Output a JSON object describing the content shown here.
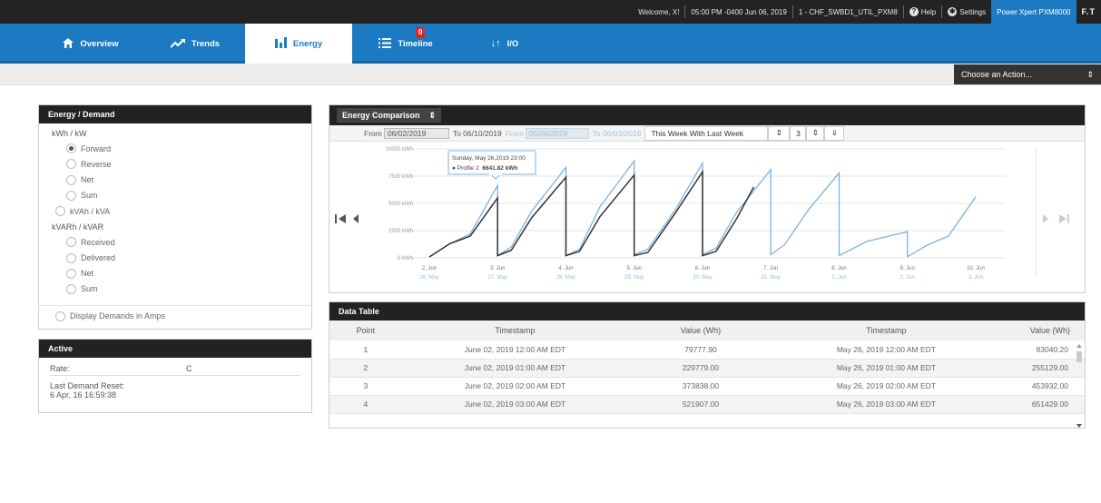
{
  "topbar": {
    "welcome": "Welcome, X!",
    "datetime": "05:00 PM -0400 Jun 06, 2019",
    "device_id": "1 - CHF_SWBD1_UTIL_PXM8",
    "help": "Help",
    "settings": "Settings",
    "product": "Power Xpert PXM8000",
    "logo": "F.T"
  },
  "nav": {
    "tabs": [
      {
        "label": "Overview",
        "icon": "home-icon"
      },
      {
        "label": "Trends",
        "icon": "trend-icon"
      },
      {
        "label": "Energy",
        "icon": "bar-chart-icon"
      },
      {
        "label": "Timeline",
        "icon": "list-icon",
        "badge": "0"
      },
      {
        "label": "I/O",
        "icon": "io-arrows-icon"
      }
    ],
    "active": "Energy"
  },
  "action": {
    "label": "Choose an Action..."
  },
  "energy_demand": {
    "title": "Energy / Demand",
    "group1": "kWh / kW",
    "forward": "Forward",
    "reverse": "Reverse",
    "net": "Net",
    "sum": "Sum",
    "kvah": "kVAh / kVA",
    "group2": "kVARh / kVAR",
    "received": "Received",
    "delivered": "Delivered",
    "net2": "Net",
    "sum2": "Sum",
    "amps": "Display Demands in Amps"
  },
  "active": {
    "title": "Active",
    "rate_label": "Rate:",
    "rate_value": "C",
    "reset_label": "Last Demand Reset:",
    "reset_value": "6 Apr, 16 16:59:38"
  },
  "chart_panel": {
    "selector": "Energy Comparison",
    "from_label": "From",
    "from_value": "06/02/2019",
    "to_label": "To 06/10/2019",
    "from2_label": "From",
    "from2_value": "05/26/2019",
    "to2_label": "To 06/03/2019",
    "period": "This Week With Last Week",
    "count": "3",
    "tooltip_date": "Sunday, May 26,2019 23:00",
    "tooltip_series": "● Profile 2",
    "tooltip_value": "6641.82 kWh"
  },
  "chart_data": {
    "type": "line",
    "ylabels": [
      "10000 kWh",
      "7500 kWh",
      "5000 kWh",
      "2500 kWh",
      "0 kWh"
    ],
    "yticks": [
      10000,
      7500,
      5000,
      2500,
      0
    ],
    "ylim": [
      0,
      10000
    ],
    "xlim": [
      0,
      8.2
    ],
    "xticks": [
      {
        "x": 0,
        "top": "2. Jun",
        "bottom": "26. May"
      },
      {
        "x": 1,
        "top": "3. Jun",
        "bottom": "27. May"
      },
      {
        "x": 2,
        "top": "4. Jun",
        "bottom": "28. May"
      },
      {
        "x": 3,
        "top": "5. Jun",
        "bottom": "29. May"
      },
      {
        "x": 4,
        "top": "6. Jun",
        "bottom": "30. May"
      },
      {
        "x": 5,
        "top": "7. Jun",
        "bottom": "31. May"
      },
      {
        "x": 6,
        "top": "8. Jun",
        "bottom": "1. Jun"
      },
      {
        "x": 7,
        "top": "9. Jun",
        "bottom": "2. Jun"
      },
      {
        "x": 8,
        "top": "10. Jun",
        "bottom": "3. Jun"
      }
    ],
    "series": [
      {
        "color": "#7ab3e0",
        "points": [
          [
            0,
            80
          ],
          [
            0.3,
            1300
          ],
          [
            0.6,
            2200
          ],
          [
            1.0,
            6640
          ],
          [
            1.0,
            200
          ],
          [
            1.2,
            1000
          ],
          [
            1.5,
            4300
          ],
          [
            2.0,
            8300
          ],
          [
            2.0,
            200
          ],
          [
            2.2,
            800
          ],
          [
            2.5,
            4700
          ],
          [
            3.0,
            8900
          ],
          [
            3.0,
            300
          ],
          [
            3.2,
            800
          ],
          [
            3.6,
            4400
          ],
          [
            4.0,
            8700
          ],
          [
            4.0,
            300
          ],
          [
            4.2,
            900
          ],
          [
            4.5,
            4200
          ],
          [
            5.0,
            8100
          ],
          [
            5.0,
            300
          ],
          [
            5.2,
            1200
          ],
          [
            5.55,
            4400
          ],
          [
            6.0,
            7800
          ],
          [
            6.0,
            200
          ],
          [
            6.4,
            1500
          ],
          [
            6.8,
            2100
          ],
          [
            7.0,
            2400
          ],
          [
            7.0,
            100
          ],
          [
            7.3,
            1200
          ],
          [
            7.6,
            2000
          ],
          [
            8.0,
            5600
          ]
        ]
      },
      {
        "color": "#333333",
        "points": [
          [
            0,
            80
          ],
          [
            0.3,
            1300
          ],
          [
            0.6,
            2000
          ],
          [
            1.0,
            5500
          ],
          [
            1.0,
            200
          ],
          [
            1.2,
            700
          ],
          [
            1.5,
            3700
          ],
          [
            2.0,
            7400
          ],
          [
            2.0,
            200
          ],
          [
            2.2,
            600
          ],
          [
            2.5,
            3800
          ],
          [
            3.0,
            7600
          ],
          [
            3.0,
            200
          ],
          [
            3.2,
            500
          ],
          [
            3.6,
            4100
          ],
          [
            4.0,
            7900
          ],
          [
            4.0,
            200
          ],
          [
            4.2,
            600
          ],
          [
            4.5,
            3600
          ],
          [
            4.75,
            6500
          ]
        ]
      }
    ]
  },
  "data_table": {
    "title": "Data Table",
    "headers": [
      "Point",
      "Timestamp",
      "Value (Wh)",
      "Timestamp",
      "Value (Wh)"
    ],
    "rows": [
      [
        "1",
        "June 02, 2019 12:00 AM EDT",
        "79777.90",
        "May 26, 2019 12:00 AM EDT",
        "83040.20"
      ],
      [
        "2",
        "June 02, 2019 01:00 AM EDT",
        "229779.00",
        "May 26, 2019 01:00 AM EDT",
        "255129.00"
      ],
      [
        "3",
        "June 02, 2019 02:00 AM EDT",
        "373838.00",
        "May 26, 2019 02:00 AM EDT",
        "453932.00"
      ],
      [
        "4",
        "June 02, 2019 03:00 AM EDT",
        "521907.00",
        "May 26, 2019 03:00 AM EDT",
        "651429.00"
      ]
    ]
  }
}
